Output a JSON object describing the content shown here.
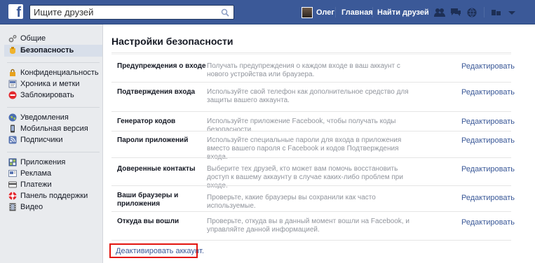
{
  "topbar": {
    "logo": "f",
    "search_placeholder": "Ищите друзей",
    "user_name": "Олег",
    "home_link": "Главная",
    "find_friends_link": "Найти друзей",
    "jewels": [
      "friend-requests-icon",
      "messages-icon",
      "notifications-icon",
      "privacy-shortcuts-icon",
      "settings-menu-icon"
    ]
  },
  "sidebar": {
    "items": [
      {
        "label": "Общие",
        "icon": "gear-icon"
      },
      {
        "label": "Безопасность",
        "icon": "badge-icon",
        "active": true
      },
      {
        "label": "Конфиденциальность",
        "icon": "lock-icon"
      },
      {
        "label": "Хроника и метки",
        "icon": "timeline-icon"
      },
      {
        "label": "Заблокировать",
        "icon": "block-icon"
      },
      {
        "label": "Уведомления",
        "icon": "globe-icon"
      },
      {
        "label": "Мобильная версия",
        "icon": "mobile-icon"
      },
      {
        "label": "Подписчики",
        "icon": "rss-icon"
      },
      {
        "label": "Приложения",
        "icon": "apps-icon"
      },
      {
        "label": "Реклама",
        "icon": "ads-icon"
      },
      {
        "label": "Платежи",
        "icon": "card-icon"
      },
      {
        "label": "Панель поддержки",
        "icon": "lifebuoy-icon"
      },
      {
        "label": "Видео",
        "icon": "film-icon"
      }
    ]
  },
  "main": {
    "title": "Настройки безопасности",
    "rows": [
      {
        "label": "Предупреждения о входе",
        "desc": "Получать предупреждения о каждом входе в ваш аккаунт с нового устройства или браузера.",
        "edit": "Редактировать"
      },
      {
        "label": "Подтверждения входа",
        "desc": "Используйте свой телефон как дополнительное средство для защиты вашего аккаунта.",
        "edit": "Редактировать"
      },
      {
        "label": "Генератор кодов",
        "desc": "Используйте приложение Facebook, чтобы получать коды безопасности.",
        "edit": "Редактировать"
      },
      {
        "label": "Пароли приложений",
        "desc": "Используйте специальные пароли для входа в приложения вместо вашего пароля с Facebook и кодов Подтверждения входа.",
        "edit": "Редактировать"
      },
      {
        "label": "Доверенные контакты",
        "desc": "Выберите тех друзей, кто может вам помочь восстановить доступ к вашему аккаунту в случае каких-либо проблем при входе.",
        "edit": "Редактировать"
      },
      {
        "label": "Ваши браузеры и приложения",
        "desc": "Проверьте, какие браузеры вы сохранили как часто используемые.",
        "edit": "Редактировать"
      },
      {
        "label": "Откуда вы вошли",
        "desc": "Проверьте, откуда вы в данный момент вошли на Facebook, и управляйте данной информацией.",
        "edit": "Редактировать"
      }
    ],
    "deactivate": "Деактивировать аккаунт."
  },
  "colors": {
    "brand": "#3b5998",
    "highlight_border": "#e2140e",
    "active_item_bg": "#d8dfea"
  }
}
